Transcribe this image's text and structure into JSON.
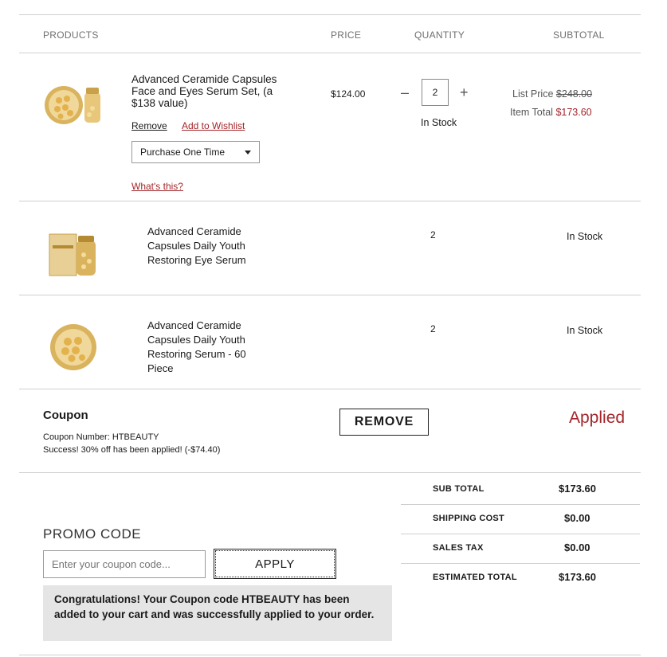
{
  "table_headers": {
    "products": "PRODUCTS",
    "price": "PRICE",
    "quantity": "QUANTITY",
    "subtotal": "SUBTOTAL"
  },
  "items": [
    {
      "name": "Advanced Ceramide Capsules Face and Eyes Serum Set, (a $138 value)",
      "price": "$124.00",
      "quantity": "2",
      "stock": "In Stock",
      "list_price_label": "List Price",
      "list_price": "$248.00",
      "item_total_label": "Item Total",
      "item_total": "$173.60",
      "remove_label": "Remove",
      "wishlist_label": "Add to Wishlist",
      "purchase_option": "Purchase One Time",
      "whats_this": "What's this?"
    },
    {
      "name": "Advanced Ceramide Capsules Daily Youth Restoring Eye Serum",
      "quantity": "2",
      "stock": "In Stock"
    },
    {
      "name": "Advanced Ceramide Capsules Daily Youth Restoring Serum - 60 Piece",
      "quantity": "2",
      "stock": "In Stock"
    }
  ],
  "coupon": {
    "title": "Coupon",
    "number_line": "Coupon Number: HTBEAUTY",
    "success_line": "Success! 30% off has been applied! (-$74.40)",
    "remove_label": "REMOVE",
    "status": "Applied"
  },
  "promo": {
    "title": "PROMO CODE",
    "placeholder": "Enter your coupon code...",
    "apply_label": "APPLY",
    "message": "Congratulations! Your Coupon code HTBEAUTY has been added to your cart and was successfully applied to your order."
  },
  "summary": [
    {
      "label": "SUB TOTAL",
      "value": "$173.60"
    },
    {
      "label": "SHIPPING COST",
      "value": "$0.00"
    },
    {
      "label": "SALES TAX",
      "value": "$0.00"
    },
    {
      "label": "ESTIMATED TOTAL",
      "value": "$173.60"
    }
  ],
  "colors": {
    "accent_red": "#a3262a",
    "divider": "#cfcfcf",
    "message_bg": "#e5e5e5",
    "gold": "#c9a14a"
  }
}
